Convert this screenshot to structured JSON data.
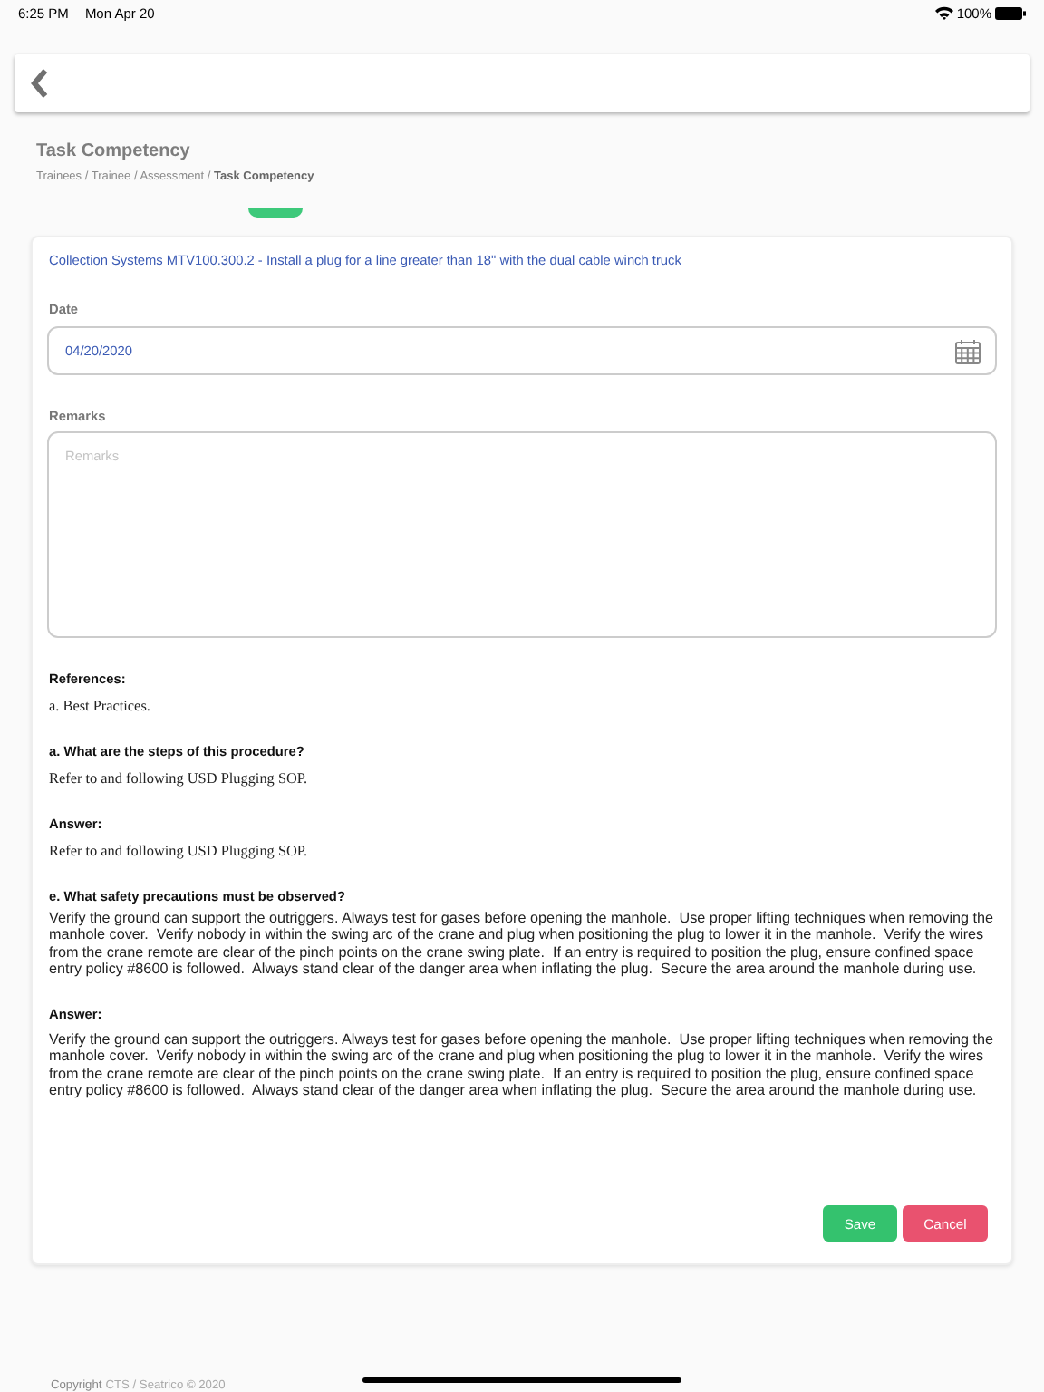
{
  "status_bar": {
    "time": "6:25 PM",
    "date": "Mon Apr 20",
    "battery": "100%"
  },
  "page": {
    "title": "Task Competency",
    "breadcrumb": "Trainees / Trainee / Assessment / **Task Competency**"
  },
  "task": {
    "title": "Collection Systems MTV100.300.2 - Install a plug for a line greater than 18\" with the dual cable winch truck",
    "date": {
      "label": "Date",
      "value": "04/20/2020"
    },
    "remarks": {
      "label": "Remarks",
      "placeholder": "Remarks"
    },
    "sections": [
      {
        "heading": "References:",
        "text": "a. Best Practices.",
        "kind": "serif"
      },
      {
        "heading": "a. What are the steps of this procedure?",
        "text": "Refer to and following USD Plugging SOP.",
        "kind": "serif"
      },
      {
        "heading": "Answer:",
        "text": "Refer to and following USD Plugging SOP.",
        "kind": "serif"
      },
      {
        "heading": "e. What safety precautions must be observed?",
        "text": "Verify the ground can support the outriggers. Always test for gases before opening the manhole.  Use proper lifting techniques when removing the manhole cover.  Verify nobody in within the swing arc of the crane and plug when positioning the plug to lower it in the manhole.  Verify the wires from the crane remote are clear of the pinch points on the crane swing plate.  If an entry is required to position the plug, ensure confined space entry policy #8600 is followed.  Always stand clear of the danger area when inflating the plug.  Secure the area around the manhole during use.",
        "kind": "sans"
      },
      {
        "heading": "Answer:",
        "text": "Verify the ground can support the outriggers. Always test for gases before opening the manhole.  Use proper lifting techniques when removing the manhole cover.  Verify nobody in within the swing arc of the crane and plug when positioning the plug to lower it in the manhole.  Verify the wires from the crane remote are clear of the pinch points on the crane swing plate.  If an entry is required to position the plug, ensure confined space entry policy #8600 is followed.  Always stand clear of the danger area when inflating the plug.  Secure the area around the manhole during use.",
        "kind": "sans"
      }
    ],
    "buttons": [
      {
        "label": "Save",
        "kind": "save"
      },
      {
        "label": "Cancel",
        "kind": "cancel"
      }
    ]
  },
  "footer": {
    "prefix": "Copyright",
    "link": "CTS / Seatrico © 2020"
  }
}
